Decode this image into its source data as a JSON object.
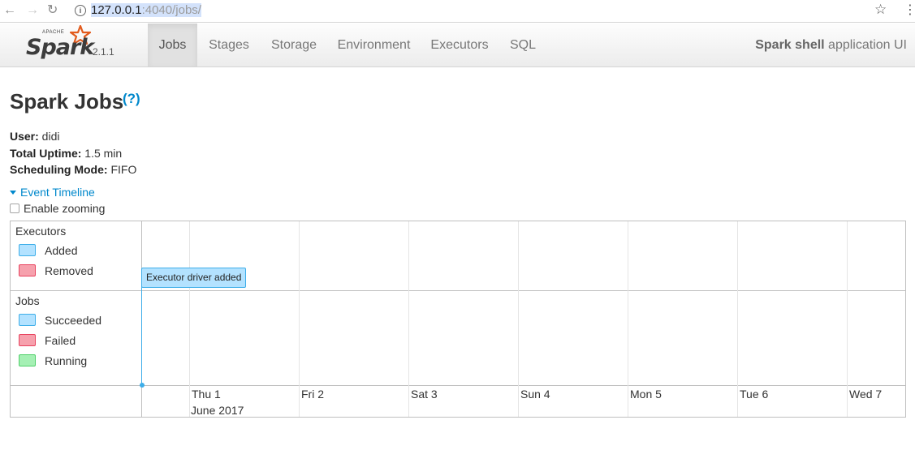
{
  "browser": {
    "url_host": "127.0.0.1",
    "url_rest": ":4040/jobs/",
    "back_glyph": "←",
    "forward_glyph": "→",
    "reload_glyph": "↻",
    "bookmark_glyph": "☆",
    "menu_glyph": "⋮",
    "info_glyph": "i"
  },
  "navbar": {
    "brand_apache": "APACHE",
    "brand_name": "Spark",
    "version": "2.1.1",
    "tabs": [
      "Jobs",
      "Stages",
      "Storage",
      "Environment",
      "Executors",
      "SQL"
    ],
    "active_tab": "Jobs",
    "app_name": "Spark shell",
    "app_suffix": " application UI"
  },
  "page": {
    "title": "Spark Jobs",
    "help": "(?)",
    "user_label": "User:",
    "user_value": " didi",
    "uptime_label": "Total Uptime:",
    "uptime_value": " 1.5 min",
    "scheduling_label": "Scheduling Mode:",
    "scheduling_value": " FIFO",
    "timeline_link": "Event Timeline",
    "zoom_label": "Enable zooming",
    "zoom_checked": false
  },
  "timeline": {
    "executors_group": "Executors",
    "executor_legend": [
      {
        "label": "Added",
        "color": "#b3e2ff",
        "border": "#3eaee9"
      },
      {
        "label": "Removed",
        "color": "#f6a1ad",
        "border": "#e8425e"
      }
    ],
    "jobs_group": "Jobs",
    "job_legend": [
      {
        "label": "Succeeded",
        "color": "#b3e2ff",
        "border": "#3eaee9"
      },
      {
        "label": "Failed",
        "color": "#f6a1ad",
        "border": "#e8425e"
      },
      {
        "label": "Running",
        "color": "#a5f0b4",
        "border": "#4fcf6a"
      }
    ],
    "event_label": "Executor driver added",
    "event_color": "#b3e2ff",
    "axis_minor": [
      "Thu 1",
      "Fri 2",
      "Sat 3",
      "Sun 4",
      "Mon 5",
      "Tue 6",
      "Wed 7"
    ],
    "axis_major": "June 2017"
  }
}
